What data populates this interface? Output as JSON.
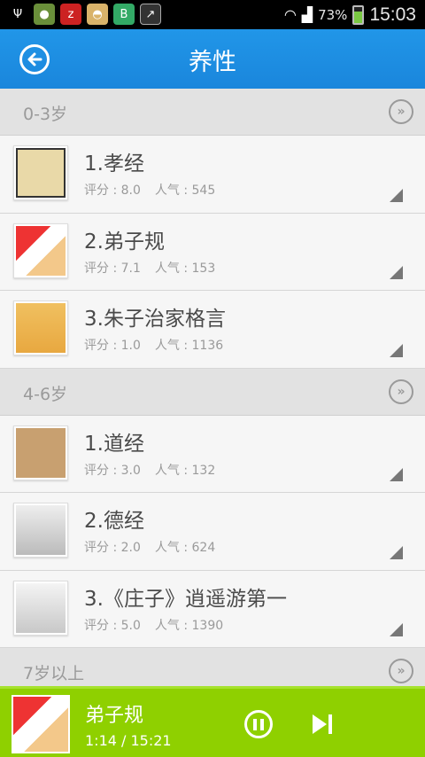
{
  "status_bar": {
    "battery": "73%",
    "time": "15:03"
  },
  "header": {
    "title": "养性"
  },
  "sections": [
    {
      "label": "0-3岁",
      "items": [
        {
          "title": "1.孝经",
          "rating": "评分 : 8.0",
          "popularity": "人气 : 545"
        },
        {
          "title": "2.弟子规",
          "rating": "评分 : 7.1",
          "popularity": "人气 : 153"
        },
        {
          "title": "3.朱子治家格言",
          "rating": "评分 : 1.0",
          "popularity": "人气 : 1136"
        }
      ]
    },
    {
      "label": "4-6岁",
      "items": [
        {
          "title": "1.道经",
          "rating": "评分 : 3.0",
          "popularity": "人气 : 132"
        },
        {
          "title": "2.德经",
          "rating": "评分 : 2.0",
          "popularity": "人气 : 624"
        },
        {
          "title": "3.《庄子》逍遥游第一",
          "rating": "评分 : 5.0",
          "popularity": "人气 : 1390"
        }
      ]
    },
    {
      "label": "7岁以上"
    }
  ],
  "player": {
    "title": "弟子规",
    "time": "1:14 / 15:21"
  }
}
